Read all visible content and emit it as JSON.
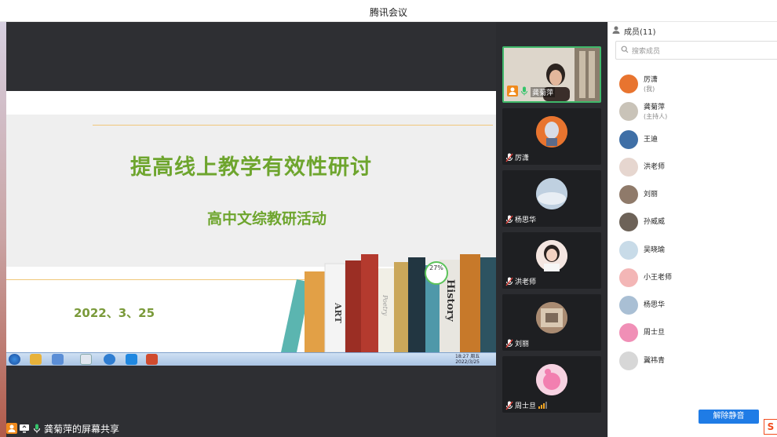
{
  "window": {
    "title": "腾讯会议"
  },
  "share": {
    "label": "龚菊萍的屏幕共享"
  },
  "slide": {
    "title": "提高线上教学有效性研讨",
    "subtitle": "高中文综教研活动",
    "date": "2022、3、25",
    "book_labels": [
      "ART",
      "History",
      "Poetry"
    ],
    "percent_badge": "27%"
  },
  "taskbar": {
    "clock_time": "18:27 周五",
    "clock_date": "2022/3/25"
  },
  "video_tiles": [
    {
      "name": "龚菊萍",
      "mic": "on",
      "color": "#e9e4dc"
    },
    {
      "name": "厉潇",
      "mic": "off",
      "color": "#e8742f"
    },
    {
      "name": "杨思华",
      "mic": "off",
      "color": "#9fb7cf"
    },
    {
      "name": "洪老师",
      "mic": "off",
      "color": "#f1d9d2"
    },
    {
      "name": "刘丽",
      "mic": "off",
      "color": "#b39276"
    },
    {
      "name": "周士旦",
      "mic": "off",
      "color": "#f4a7c8"
    }
  ],
  "members": {
    "header": "成员(11)",
    "search_placeholder": "搜索成员",
    "list": [
      {
        "name": "厉潇",
        "role": "(我)",
        "color": "#e8742f"
      },
      {
        "name": "龚菊萍",
        "role": "(主持人)",
        "color": "#c9c3b8"
      },
      {
        "name": "王迪",
        "role": "",
        "color": "#3f6fa6"
      },
      {
        "name": "洪老师",
        "role": "",
        "color": "#e6d6cf"
      },
      {
        "name": "刘丽",
        "role": "",
        "color": "#8f7a6a"
      },
      {
        "name": "孙威威",
        "role": "",
        "color": "#6d6258"
      },
      {
        "name": "吴晓瑜",
        "role": "",
        "color": "#c8dbe8"
      },
      {
        "name": "小王老师",
        "role": "",
        "color": "#f3b6b6"
      },
      {
        "name": "杨思华",
        "role": "",
        "color": "#a9bfd4"
      },
      {
        "name": "周士旦",
        "role": "",
        "color": "#f08fb6"
      },
      {
        "name": "冀祎青",
        "role": "",
        "color": "#d7d7d7"
      }
    ],
    "unmute_label": "解除静音"
  },
  "ime": {
    "label": "S"
  }
}
